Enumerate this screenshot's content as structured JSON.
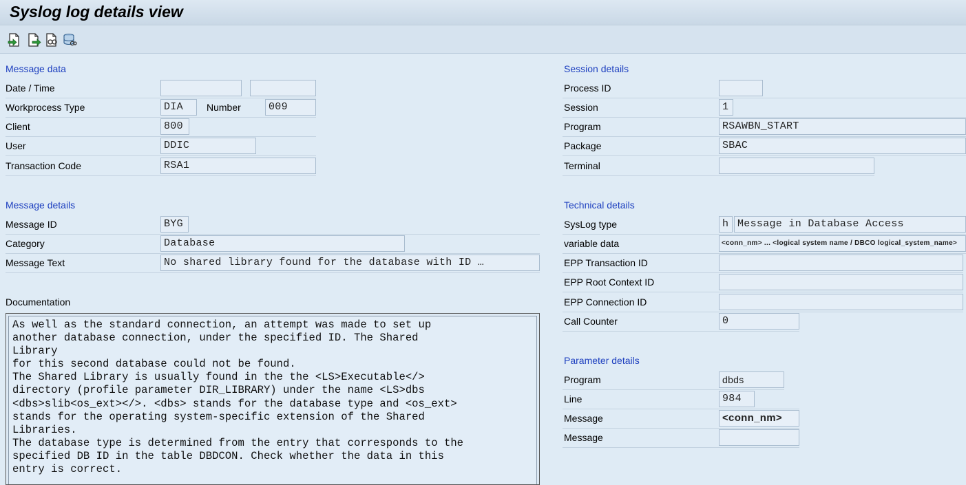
{
  "window": {
    "title": "Syslog log details view"
  },
  "toolbar": {
    "buttons": [
      "previous-icon",
      "next-icon",
      "detail-icon",
      "database-icon"
    ]
  },
  "message_data": {
    "heading": "Message data",
    "date_time_label": "Date / Time",
    "date_value": "",
    "time_value": "",
    "workprocess_type_label": "Workprocess Type",
    "workprocess_type_value": "DIA",
    "number_label": "Number",
    "number_value": "009",
    "client_label": "Client",
    "client_value": "800",
    "user_label": "User",
    "user_value": "DDIC",
    "transaction_code_label": "Transaction Code",
    "transaction_code_value": "RSA1"
  },
  "message_details": {
    "heading": "Message details",
    "message_id_label": "Message ID",
    "message_id_value": "BYG",
    "category_label": "Category",
    "category_value": "Database",
    "message_text_label": "Message Text",
    "message_text_value": "No shared library found for the database with ID …"
  },
  "documentation": {
    "label": "Documentation",
    "text": "As well as the standard connection, an attempt was made to set up\nanother database connection, under the specified ID. The Shared\nLibrary\nfor this second database could not be found.\nThe Shared Library is usually found in the the <LS>Executable</>\ndirectory (profile parameter DIR_LIBRARY) under the name <LS>dbs\n<dbs>slib<os_ext></>. <dbs> stands for the database type and <os_ext>\nstands for the operating system-specific extension of the Shared\nLibraries.\nThe database type is determined from the entry that corresponds to the\nspecified DB ID in the table DBDCON. Check whether the data in this\nentry is correct."
  },
  "session_details": {
    "heading": "Session details",
    "process_id_label": "Process ID",
    "process_id_value": "",
    "session_label": "Session",
    "session_value": "1",
    "program_label": "Program",
    "program_value": "RSAWBN_START",
    "package_label": "Package",
    "package_value": "SBAC",
    "terminal_label": "Terminal",
    "terminal_value": ""
  },
  "technical_details": {
    "heading": "Technical details",
    "syslog_type_label": "SysLog type",
    "syslog_type_code": "h",
    "syslog_type_text": "Message in Database Access",
    "variable_data_label": "variable data",
    "variable_data_value": "<conn_nm>  ...  <logical system name / DBCO logical_system_name>",
    "epp_transaction_id_label": "EPP Transaction ID",
    "epp_transaction_id_value": "",
    "epp_root_context_id_label": "EPP Root Context ID",
    "epp_root_context_id_value": "",
    "epp_connection_id_label": "EPP Connection ID",
    "epp_connection_id_value": "",
    "call_counter_label": "Call Counter",
    "call_counter_value": "0"
  },
  "parameter_details": {
    "heading": "Parameter details",
    "program_label": "Program",
    "program_value": "dbds",
    "line_label": "Line",
    "line_value": "984",
    "message1_label": "Message",
    "message1_value": "<conn_nm>",
    "message2_label": "Message",
    "message2_value": ""
  }
}
